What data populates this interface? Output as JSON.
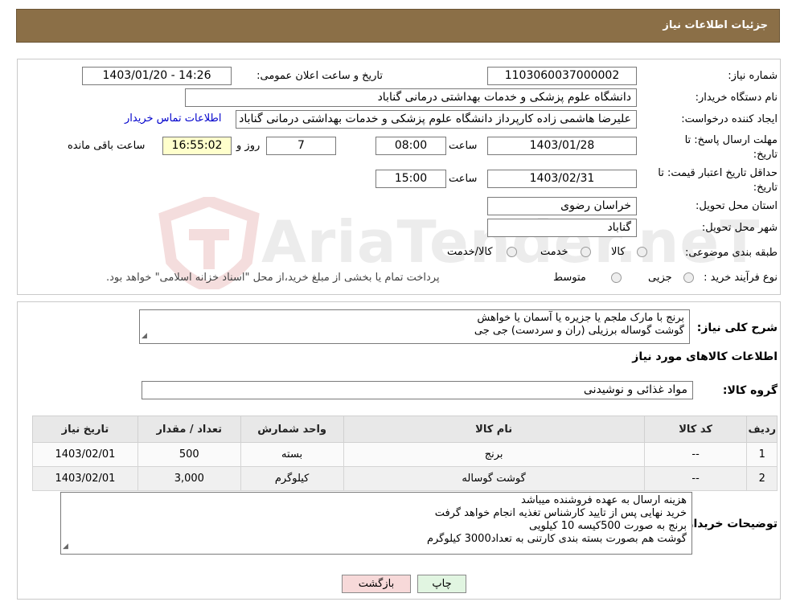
{
  "header": {
    "title": "جزئیات اطلاعات نیاز"
  },
  "fields": {
    "need_number_label": "شماره نیاز:",
    "need_number": "1103060037000002",
    "announce_label": "تاریخ و ساعت اعلان عمومی:",
    "announce_value": "1403/01/20 - 14:26",
    "buyer_org_label": "نام دستگاه خریدار:",
    "buyer_org": "دانشگاه علوم پزشکی و خدمات بهداشتی درمانی گناباد",
    "creator_label": "ایجاد کننده درخواست:",
    "creator": "علیرضا هاشمی زاده کارپرداز دانشگاه علوم پزشکی و خدمات بهداشتی درمانی گناباد",
    "contact_link": "اطلاعات تماس خریدار",
    "deadline_label_1": "مهلت ارسال پاسخ: تا",
    "deadline_label_2": "تاریخ:",
    "deadline_date": "1403/01/28",
    "time_label": "ساعت",
    "deadline_time": "08:00",
    "days": "7",
    "days_label": "روز و",
    "remaining_time": "16:55:02",
    "remaining_label": "ساعت باقی مانده",
    "validity_label_1": "حداقل تاریخ اعتبار قیمت: تا",
    "validity_label_2": "تاریخ:",
    "validity_date": "1403/02/31",
    "validity_time": "15:00",
    "province_label": "استان محل تحویل:",
    "province": "خراسان رضوی",
    "city_label": "شهر محل تحویل:",
    "city": "گناباد",
    "category_label": "طبقه بندی موضوعی:",
    "category_options": [
      "کالا",
      "خدمت",
      "کالا/خدمت"
    ],
    "process_label": "نوع فرآیند خرید :",
    "process_options": [
      "جزیی",
      "متوسط"
    ],
    "process_note": "پرداخت تمام یا بخشی از مبلغ خرید،از محل \"اسناد خزانه اسلامی\" خواهد بود."
  },
  "watermark": "AriaTender.neT",
  "description": {
    "label": "شرح کلی نیاز:",
    "lines": [
      "برنج با مارک ملجم یا جزیره یا آسمان یا خواهش",
      "گوشت گوساله برزیلی (ران و سردست) جی جی"
    ]
  },
  "items_heading": "اطلاعات کالاهای مورد نیاز",
  "goods_group_label": "گروه کالا:",
  "goods_group": "مواد غذائی و نوشیدنی",
  "table": {
    "headers": [
      "ردیف",
      "کد کالا",
      "نام کالا",
      "واحد شمارش",
      "تعداد / مقدار",
      "تاریخ نیاز"
    ],
    "rows": [
      [
        "1",
        "--",
        "برنج",
        "بسته",
        "500",
        "1403/02/01"
      ],
      [
        "2",
        "--",
        "گوشت گوساله",
        "کیلوگرم",
        "3,000",
        "1403/02/01"
      ]
    ]
  },
  "buyer_notes": {
    "label": "توضیحات خریدار:",
    "lines": [
      "هزینه ارسال به عهده فروشنده میباشد",
      "خرید نهایی پس از تایید کارشناس تغذیه انجام خواهد گرفت",
      "برنج به صورت 500کیسه  10 کیلویی",
      "گوشت هم بصورت بسته بندی کارتنی به تعداد3000 کیلوگرم"
    ]
  },
  "buttons": {
    "print": "چاپ",
    "back": "بازگشت"
  },
  "colors": {
    "header_bg": "#8b6f47",
    "time_bg": "#ffffcc",
    "back_btn": "#f7d9d9",
    "print_btn": "#e1f5e1",
    "link": "#0000cc"
  }
}
